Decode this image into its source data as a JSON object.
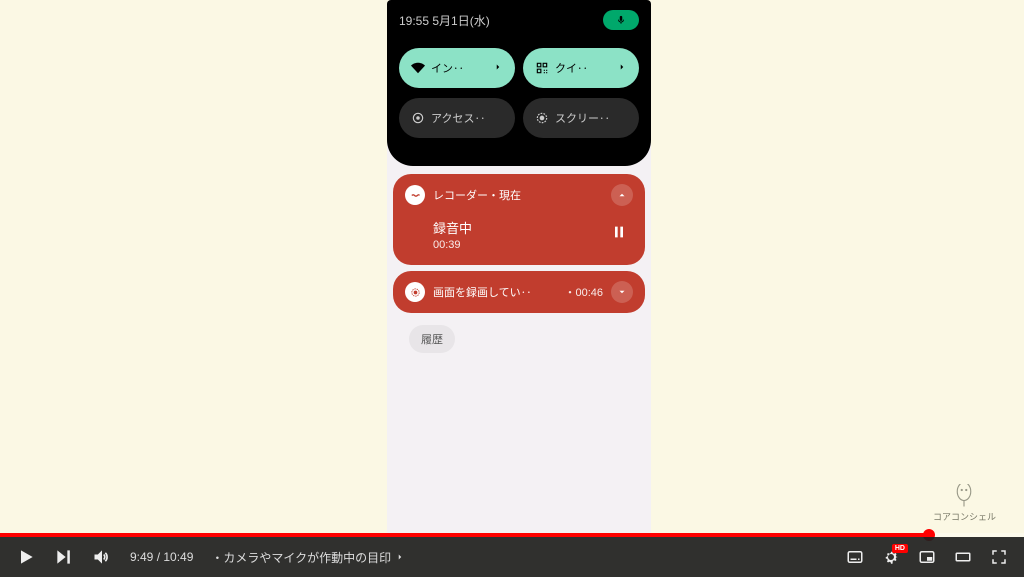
{
  "phone": {
    "status_time": "19:55",
    "status_date": "5月1日(水)",
    "tiles": {
      "wifi": "イン‥",
      "qr": "クイ‥",
      "access": "アクセス‥",
      "screen": "スクリー‥"
    },
    "notif1": {
      "app": "レコーダー・現在",
      "title": "録音中",
      "time": "00:39"
    },
    "notif2": {
      "text": "画面を録画してい‥",
      "dur": "・00:46"
    },
    "history": "履歴"
  },
  "brand": "コアコンシェル",
  "player": {
    "current": "9:49",
    "total": "10:49",
    "chapter": "・カメラやマイクが作動中の目印",
    "hd": "HD",
    "progress_pct": 90.7
  }
}
